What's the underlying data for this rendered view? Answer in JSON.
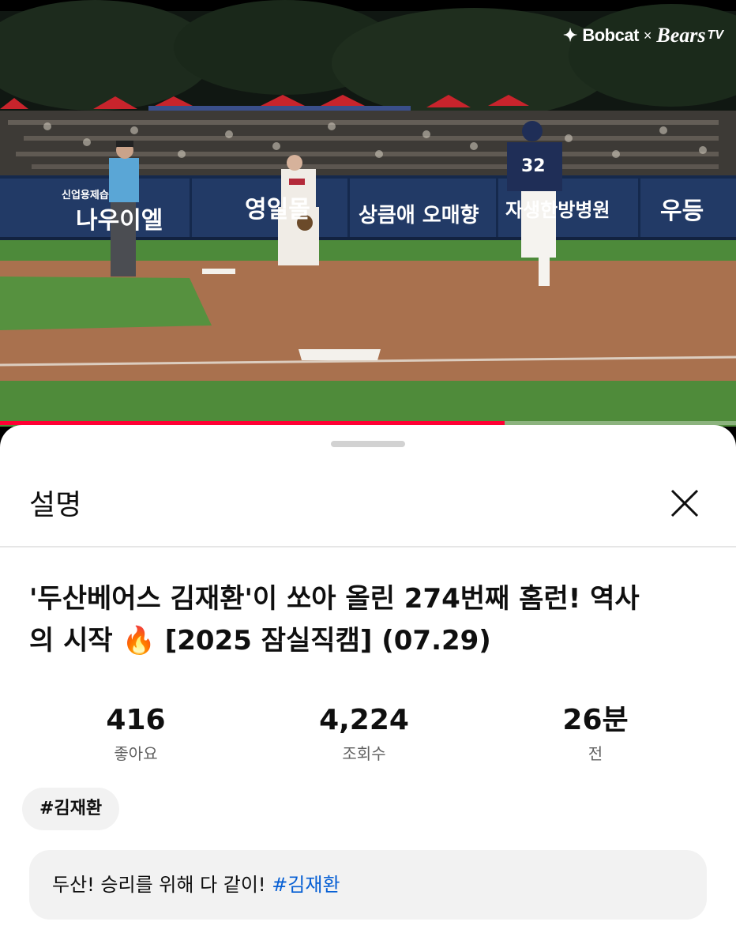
{
  "video": {
    "watermark": {
      "brand1": "Bobcat",
      "separator": "×",
      "brand2": "Bears",
      "brand2_suffix": "TV"
    },
    "stadium_signs": [
      "신업용제습",
      "나우이엘",
      "영일몰",
      "상큼애 오매향",
      "자생한방병원",
      "우등"
    ],
    "player_number": "32",
    "progress_fraction": 0.686,
    "colors": {
      "progress": "#ff0033"
    }
  },
  "sheet": {
    "title": "설명",
    "close_icon": "close-icon",
    "video_title_line1": "'두산베어스 김재환'이 쏘아 올린 274번째 홈런! 역사",
    "video_title_line2_prefix": "의 시작",
    "video_title_emoji": "🔥",
    "video_title_line2_suffix": "[2025 잠실직캠] (07.29)",
    "stats": [
      {
        "value": "416",
        "label": "좋아요"
      },
      {
        "value": "4,224",
        "label": "조회수"
      },
      {
        "value": "26분",
        "label": "전"
      }
    ],
    "hashtag_chip": "#김재환",
    "description_text": "두산! 승리를 위해 다 같이! ",
    "description_tag": "#김재환",
    "colors": {
      "link": "#065fd4",
      "chip_bg": "#f2f2f2"
    }
  }
}
